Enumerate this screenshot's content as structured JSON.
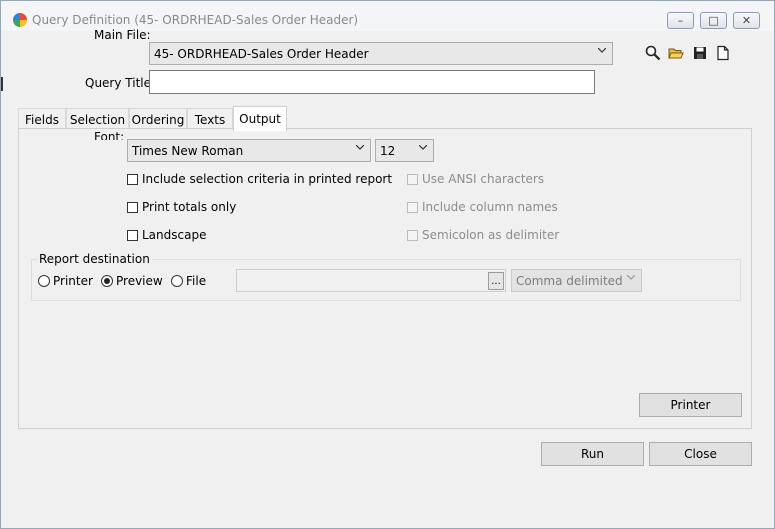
{
  "window": {
    "title": "Query Definition (45- ORDRHEAD-Sales Order Header)",
    "minimize": "–",
    "maximize": "□",
    "close": "✕"
  },
  "header": {
    "main_file_label": "Main File:",
    "main_file_value": "45- ORDRHEAD-Sales Order Header",
    "query_title_label": "Query Title:",
    "query_title_value": ""
  },
  "toolbar_icons": [
    "search-icon",
    "open-folder-icon",
    "save-icon",
    "new-document-icon"
  ],
  "tabs": [
    {
      "label": "Fields"
    },
    {
      "label": "Selection"
    },
    {
      "label": "Ordering"
    },
    {
      "label": "Texts"
    },
    {
      "label": "Output",
      "active": true
    }
  ],
  "output": {
    "font_label": "Font:",
    "font_value": "Times New Roman",
    "font_size": "12",
    "include_selection": {
      "label": "Include selection criteria in printed report",
      "checked": false
    },
    "print_totals": {
      "label": "Print totals only",
      "checked": false
    },
    "landscape": {
      "label": "Landscape",
      "checked": false
    },
    "use_ansi": {
      "label": "Use ANSI characters",
      "checked": false
    },
    "include_column_names": {
      "label": "Include column names",
      "checked": false
    },
    "semicolon": {
      "label": "Semicolon as delimiter",
      "checked": false
    },
    "report_destination": {
      "title": "Report destination",
      "printer": "Printer",
      "preview": "Preview",
      "file": "File",
      "selected": "Preview",
      "file_path": "",
      "browse": "...",
      "format": "Comma delimited"
    },
    "printer_button": "Printer"
  },
  "footer": {
    "run": "Run",
    "close": "Close"
  }
}
